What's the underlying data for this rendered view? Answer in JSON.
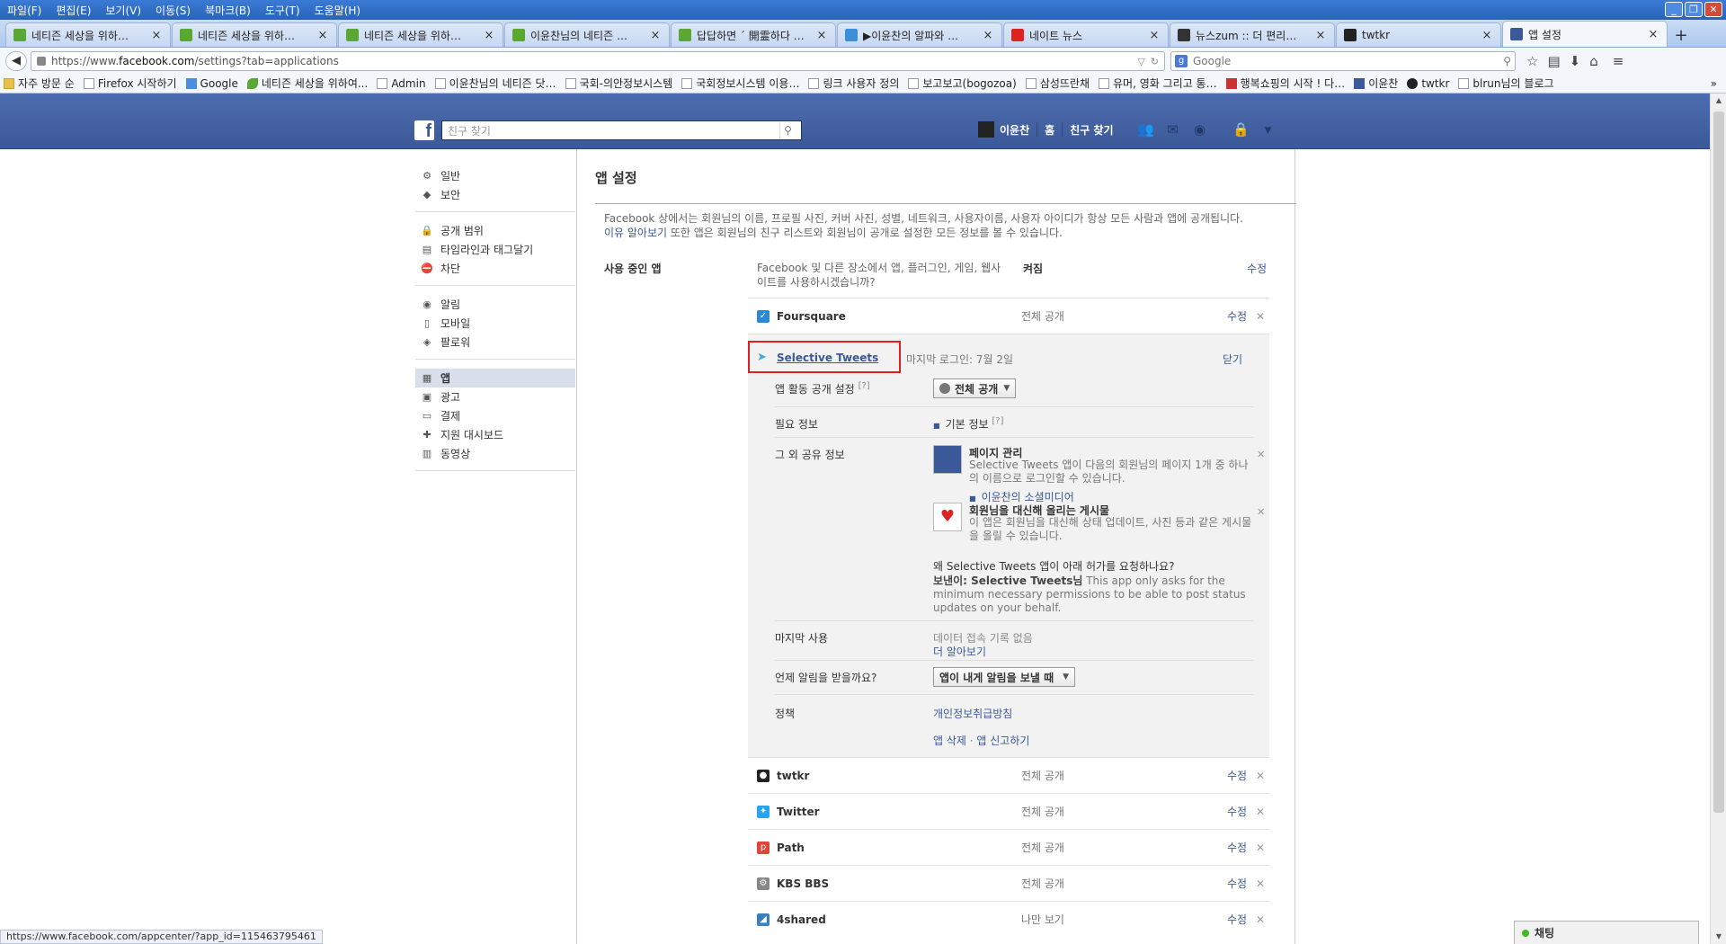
{
  "menubar": {
    "items": [
      "파일(F)",
      "편집(E)",
      "보기(V)",
      "이동(S)",
      "북마크(B)",
      "도구(T)",
      "도움말(H)"
    ],
    "window_controls": [
      "_",
      "❐",
      "✕"
    ]
  },
  "tabs": [
    {
      "label": "네티즌 세상을 위하…",
      "icon": "leaf-icon",
      "color": "#5aa832"
    },
    {
      "label": "네티즌 세상을 위하…",
      "icon": "leaf-icon",
      "color": "#5aa832"
    },
    {
      "label": "네티즌 세상을 위하…",
      "icon": "leaf-icon",
      "color": "#5aa832"
    },
    {
      "label": "이윤찬님의 네티즌 …",
      "icon": "leaf-icon",
      "color": "#5aa832"
    },
    {
      "label": "답답하면 ´ 開霊하다 …",
      "icon": "leaf-icon",
      "color": "#5aa832"
    },
    {
      "label": "▶이윤찬의 알파와 …",
      "icon": "drive-icon",
      "color": "#3a8fd8"
    },
    {
      "label": "네이트 뉴스",
      "icon": "nate-icon",
      "color": "#d22"
    },
    {
      "label": "뉴스zum :: 더 편리…",
      "icon": "zum-icon",
      "color": "#333"
    },
    {
      "label": "twtkr",
      "icon": "twtkr-icon",
      "color": "#222"
    },
    {
      "label": "앱 설정",
      "icon": "facebook-icon",
      "color": "#3b5998",
      "active": true
    }
  ],
  "navbar": {
    "url_prefix": "https://www.",
    "url_host": "facebook.com",
    "url_path": "/settings?tab=applications",
    "search_placeholder": "Google"
  },
  "bookmarks": [
    {
      "label": "자주 방문 순",
      "icon": "sp"
    },
    {
      "label": "Firefox 시작하기",
      "icon": ""
    },
    {
      "label": "Google",
      "icon": "g"
    },
    {
      "label": "네티즌 세상을 위하여...",
      "icon": "lf"
    },
    {
      "label": "Admin",
      "icon": ""
    },
    {
      "label": "이윤찬님의 네티즌 닷…",
      "icon": ""
    },
    {
      "label": "국회-의안정보시스템",
      "icon": ""
    },
    {
      "label": "국회정보시스템 이용…",
      "icon": ""
    },
    {
      "label": "링크 사용자 정의",
      "icon": ""
    },
    {
      "label": "보고보고(bogozoa)",
      "icon": ""
    },
    {
      "label": "삼성뜨란채",
      "icon": ""
    },
    {
      "label": "유머, 영화 그리고 통…",
      "icon": ""
    },
    {
      "label": "행복쇼핑의 시작 ! 다…",
      "icon": "rd"
    },
    {
      "label": "이윤찬",
      "icon": "fb"
    },
    {
      "label": "twtkr",
      "icon": "bk"
    },
    {
      "label": "blrun님의 블로그",
      "icon": ""
    }
  ],
  "fb": {
    "search_placeholder": "친구 찾기",
    "user_name": "이윤찬",
    "home": "홈",
    "find_friends": "친구 찾기"
  },
  "leftnav": {
    "groups": [
      [
        {
          "label": "일반",
          "icon": "gear-icon",
          "glyph": "⚙"
        },
        {
          "label": "보안",
          "icon": "badge-icon",
          "glyph": "◆"
        }
      ],
      [
        {
          "label": "공개 범위",
          "icon": "lock-icon",
          "glyph": "🔒"
        },
        {
          "label": "타임라인과 태그달기",
          "icon": "timeline-icon",
          "glyph": "▤"
        },
        {
          "label": "차단",
          "icon": "block-icon",
          "glyph": "⛔"
        }
      ],
      [
        {
          "label": "알림",
          "icon": "globe-icon",
          "glyph": "◉"
        },
        {
          "label": "모바일",
          "icon": "mobile-icon",
          "glyph": "▯"
        },
        {
          "label": "팔로워",
          "icon": "rss-icon",
          "glyph": "◈"
        }
      ],
      [
        {
          "label": "앱",
          "icon": "apps-icon",
          "glyph": "▦",
          "selected": true
        },
        {
          "label": "광고",
          "icon": "ads-icon",
          "glyph": "▣"
        },
        {
          "label": "결제",
          "icon": "card-icon",
          "glyph": "▭"
        },
        {
          "label": "지원 대시보드",
          "icon": "support-icon",
          "glyph": "✚"
        },
        {
          "label": "동영상",
          "icon": "video-icon",
          "glyph": "▥"
        }
      ]
    ]
  },
  "main": {
    "title": "앱 설정",
    "intro_text": "Facebook 상에서는 회원님의 이름, 프로필 사진, 커버 사진, 성별, 네트워크, 사용자이름, 사용자 아이디가 항상 모든 사람과 앱에 공개됩니다.",
    "intro_link": "이유 알아보기",
    "intro_text2": " 또한 앱은 회원님의 친구 리스트와 회원님이 공개로 설정한 모든 정보를 볼 수 있습니다.",
    "section_label": "사용 중인 앱",
    "question": "Facebook 및 다른 장소에서 앱, 플러그인, 게임, 웹사이트를 사용하시겠습니까?",
    "status_on": "켜짐",
    "edit": "수정"
  },
  "apps_top": [
    {
      "name": "Foursquare",
      "privacy": "전체 공개",
      "edit": "수정",
      "icon": "foursquare-icon",
      "color": "#2b8ad6",
      "glyph": "✓"
    }
  ],
  "selected_app": {
    "name": "Selective Tweets",
    "last_login": "마지막 로그인: 7월 2일",
    "close": "닫기",
    "visibility_label": "앱 활동 공개 설정",
    "visibility_help": "[?]",
    "visibility_value": "전체 공개",
    "required_label": "필요 정보",
    "required_value": "기본 정보",
    "required_help": "[?]",
    "other_label": "그 외 공유 정보",
    "perm1_title": "페이지 관리",
    "perm1_desc": "Selective Tweets 앱이 다음의 회원님의 페이지 1개 중 하나의 이름으로 로그인할 수 있습니다.",
    "perm1_page": "이윤찬의 소셜미디어",
    "perm2_title": "회원님을 대신해 올리는 게시물",
    "perm2_desc": "이 앱은 회원님을 대신해 상태 업데이트, 사진 등과 같은 게시물을 올릴 수 있습니다.",
    "why_title": "왜 Selective Tweets 앱이 아래 허가를 요청하나요?",
    "sender_label": "보낸이: Selective Tweets님",
    "sender_msg": "This app only asks for the minimum necessary permissions to be able to post status updates on your behalf.",
    "last_use_label": "마지막 사용",
    "last_use_value": "데이터 접속 기록 없음",
    "learn_more": "더 알아보기",
    "notify_label": "언제 알림을 받을까요?",
    "notify_value": "앱이 내게 알림을 보낼 때",
    "policy_label": "정책",
    "policy_link": "개인정보취급방침",
    "remove_app": "앱 삭제",
    "dot": " · ",
    "report_app": "앱 신고하기"
  },
  "apps_bottom": [
    {
      "name": "twtkr",
      "privacy": "전체 공개",
      "edit": "수정",
      "icon": "twtkr-icon",
      "color": "#222",
      "glyph": "●"
    },
    {
      "name": "Twitter",
      "privacy": "전체 공개",
      "edit": "수정",
      "icon": "twitter-icon",
      "color": "#2aa3ef",
      "glyph": "✦"
    },
    {
      "name": "Path",
      "privacy": "전체 공개",
      "edit": "수정",
      "icon": "path-icon",
      "color": "#e0443a",
      "glyph": "p"
    },
    {
      "name": "KBS BBS",
      "privacy": "전체 공개",
      "edit": "수정",
      "icon": "kbs-icon",
      "color": "#888",
      "glyph": "⚙"
    },
    {
      "name": "4shared",
      "privacy": "나만 보기",
      "edit": "수정",
      "icon": "4shared-icon",
      "color": "#3a7fc0",
      "glyph": "◢"
    }
  ],
  "status_url": "https://www.facebook.com/appcenter/?app_id=115463795461",
  "chat_label": "채팅"
}
